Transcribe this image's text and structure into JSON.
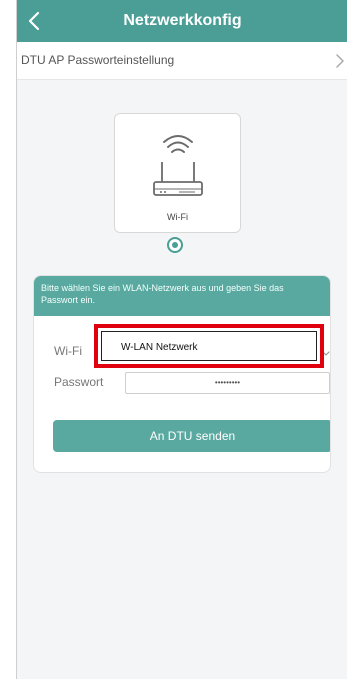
{
  "header": {
    "title": "Netzwerkkonfig",
    "back_icon": "chevron-left-icon"
  },
  "settings_row": {
    "label": "DTU AP Passworteinstellung",
    "chevron_icon": "chevron-right-icon"
  },
  "device": {
    "label": "Wi-Fi",
    "icon": "wifi-router-icon",
    "selected": true
  },
  "form": {
    "notice": "Bitte wählen Sie ein WLAN-Netzwerk aus und geben Sie das Passwort ein.",
    "wifi_label": "Wi-Fi",
    "wifi_value": "W-LAN Netzwerk",
    "password_label": "Passwort",
    "password_value": "•••••••••",
    "submit_label": "An DTU senden"
  },
  "colors": {
    "accent": "#4a9e95",
    "highlight": "#e0000f"
  }
}
